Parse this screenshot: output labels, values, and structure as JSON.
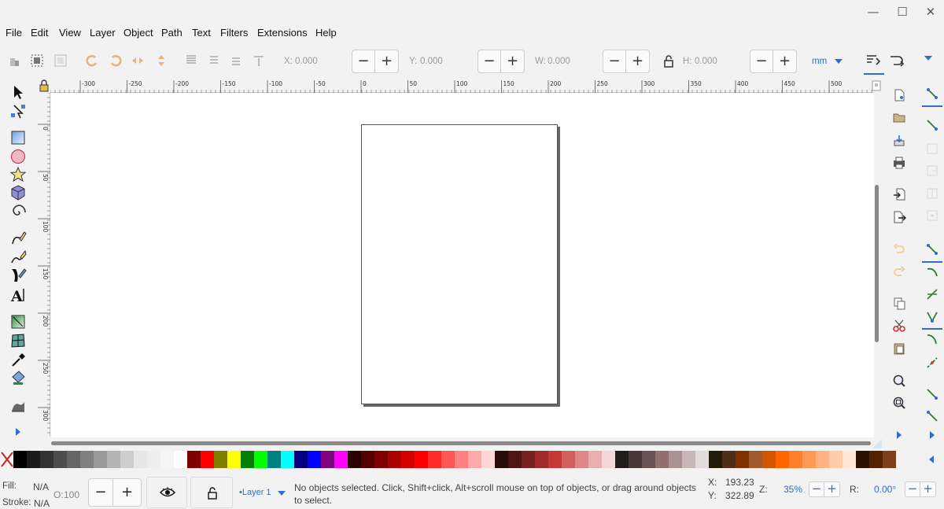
{
  "window": {
    "minimize_glyph": "—",
    "maximize_glyph": "☐",
    "close_glyph": "✕"
  },
  "menu": {
    "items": [
      "File",
      "Edit",
      "View",
      "Layer",
      "Object",
      "Path",
      "Text",
      "Filters",
      "Extensions",
      "Help"
    ]
  },
  "toolbar": {
    "x_label": "X:",
    "x_value": "0.000",
    "y_label": "Y:",
    "y_value": "0.000",
    "w_label": "W:",
    "w_value": "0.000",
    "h_label": "H:",
    "h_value": "0.000",
    "minus": "−",
    "plus": "+",
    "unit": "mm"
  },
  "ruler": {
    "top_labels": [
      "-300",
      "-250",
      "-200",
      "-150",
      "-100",
      "-50",
      "0",
      "50",
      "100",
      "150",
      "200",
      "250",
      "300",
      "350",
      "400",
      "450",
      "500"
    ],
    "left_labels": [
      "0",
      "50",
      "100",
      "150",
      "200",
      "250",
      "300"
    ]
  },
  "palette": {
    "colors": [
      "#000000",
      "#1a1a1a",
      "#333333",
      "#4d4d4d",
      "#666666",
      "#808080",
      "#999999",
      "#b3b3b3",
      "#cccccc",
      "#e6e6e6",
      "#eeeeee",
      "#f5f5f5",
      "#ffffff",
      "#800000",
      "#ff0000",
      "#808000",
      "#ffff00",
      "#008000",
      "#00ff00",
      "#008080",
      "#00ffff",
      "#000080",
      "#0000ff",
      "#800080",
      "#ff00ff",
      "#2b0000",
      "#550000",
      "#800000",
      "#aa0000",
      "#d40000",
      "#ff0000",
      "#ff2a2a",
      "#ff5555",
      "#ff8080",
      "#ffaaaa",
      "#ffd5d5",
      "#280b0b",
      "#501616",
      "#782121",
      "#a02c2c",
      "#c83737",
      "#d35f5f",
      "#de8787",
      "#e9afaf",
      "#f4d7d7",
      "#241c1c",
      "#483737",
      "#6c5353",
      "#916f6f",
      "#ac9393",
      "#c8b7b7",
      "#e3dbdb",
      "#241c0b",
      "#502d16",
      "#803300",
      "#a05a2c",
      "#d45500",
      "#ff6600",
      "#ff7f2a",
      "#ff9955",
      "#ffb380",
      "#ffccaa",
      "#ffe6d5",
      "#2b1100",
      "#552200",
      "#7f3f1f"
    ]
  },
  "status": {
    "fill_label": "Fill:",
    "fill_value": "N/A",
    "stroke_label": "Stroke:",
    "stroke_value": "N/A",
    "opacity_label": "O:",
    "opacity_value": "100",
    "layer_name": "•Layer 1",
    "message": "No objects selected. Click, Shift+click, Alt+scroll mouse on top of objects, or drag around objects to select.",
    "x_label": "X:",
    "x_value": "193.23",
    "y_label": "Y:",
    "y_value": "322.89",
    "zoom_label": "Z:",
    "zoom_value": "35%",
    "rotation_label": "R:",
    "rotation_value": "0.00°"
  },
  "colors": {
    "accent": "#2f6fc7",
    "page_shadow": "#666666"
  }
}
